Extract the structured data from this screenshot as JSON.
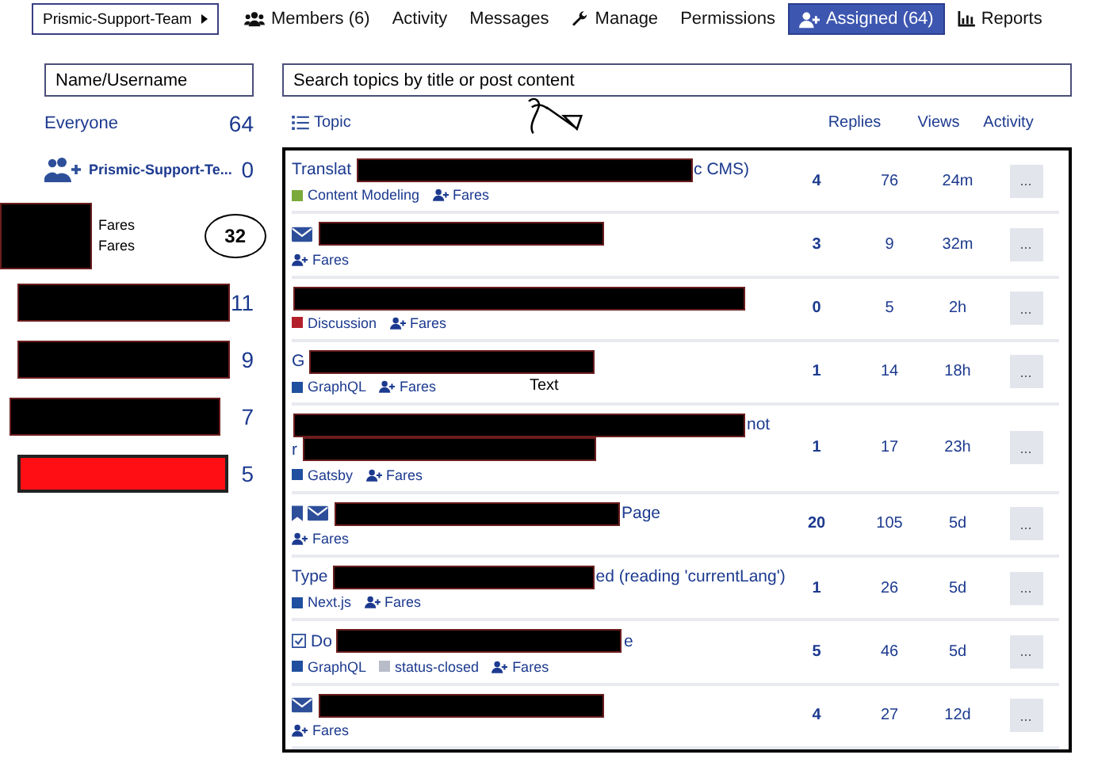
{
  "nav": {
    "group_button": "Prismic-Support-Team",
    "tabs": [
      {
        "label": "Members (6)",
        "selected": false
      },
      {
        "label": "Activity",
        "selected": false
      },
      {
        "label": "Messages",
        "selected": false
      },
      {
        "label": "Manage",
        "selected": false
      },
      {
        "label": "Permissions",
        "selected": false
      },
      {
        "label": "Assigned (64)",
        "selected": true
      },
      {
        "label": "Reports",
        "selected": false
      }
    ]
  },
  "sidebar": {
    "filter": {
      "placeholder": "Name/Username"
    },
    "items": [
      {
        "kind": "all",
        "label": "Everyone",
        "count": "64",
        "circled": false
      },
      {
        "kind": "group",
        "label": "Prismic-Support-Te...",
        "count": "0",
        "circled": false
      },
      {
        "kind": "member",
        "lines": [
          "Fares",
          "Fares"
        ],
        "color": "#000000",
        "count": "32",
        "circled": true
      },
      {
        "kind": "member",
        "color": "#000000",
        "count": "11",
        "circled": false
      },
      {
        "kind": "member",
        "color": "#000000",
        "count": "9",
        "circled": false
      },
      {
        "kind": "member",
        "color": "#000000",
        "count": "7",
        "circled": false
      },
      {
        "kind": "member",
        "color": "#ff0f13",
        "count": "5",
        "circled": false
      }
    ]
  },
  "search": {
    "placeholder": "Search topics by title or post content"
  },
  "columns": [
    "Topic",
    "Replies",
    "Views",
    "Activity"
  ],
  "handwritten_note": "Text",
  "topics": [
    {
      "bookmarked": false,
      "message": false,
      "solved": false,
      "segments": [
        {
          "kind": "text",
          "text": "Translat"
        },
        {
          "kind": "redaction"
        },
        {
          "kind": "text",
          "text": "c CMS)"
        }
      ],
      "tags": [
        {
          "label": "Content Modeling",
          "color": "#7aaa3a"
        }
      ],
      "assignee": "Fares",
      "replies": "4",
      "views": "76",
      "activity": "24m",
      "menu": "..."
    },
    {
      "bookmarked": false,
      "message": true,
      "solved": false,
      "segments": [
        {
          "kind": "redaction"
        }
      ],
      "assignee": "Fares",
      "replies": "3",
      "views": "9",
      "activity": "32m",
      "menu": "..."
    },
    {
      "bookmarked": false,
      "message": false,
      "solved": false,
      "segments": [
        {
          "kind": "redaction"
        }
      ],
      "tags": [
        {
          "label": "Discussion",
          "color": "#b3202a"
        }
      ],
      "assignee": "Fares",
      "replies": "0",
      "views": "5",
      "activity": "2h",
      "menu": "..."
    },
    {
      "bookmarked": false,
      "message": false,
      "solved": false,
      "segments": [
        {
          "kind": "text",
          "text": "G"
        },
        {
          "kind": "redaction"
        }
      ],
      "tags": [
        {
          "label": "GraphQL",
          "color": "#1f4f9e"
        }
      ],
      "assignee": "Fares",
      "replies": "1",
      "views": "14",
      "activity": "18h",
      "menu": "..."
    },
    {
      "bookmarked": false,
      "message": false,
      "solved": false,
      "segments": [
        {
          "kind": "redaction"
        },
        {
          "kind": "text",
          "text": "not"
        },
        {
          "kind": "break"
        },
        {
          "kind": "text",
          "text": "r"
        },
        {
          "kind": "redaction"
        }
      ],
      "tags": [
        {
          "label": "Gatsby",
          "color": "#1f4f9e"
        }
      ],
      "assignee": "Fares",
      "replies": "1",
      "views": "17",
      "activity": "23h",
      "menu": "..."
    },
    {
      "bookmarked": true,
      "message": true,
      "solved": false,
      "segments": [
        {
          "kind": "redaction"
        },
        {
          "kind": "text",
          "text": "Page"
        }
      ],
      "assignee": "Fares",
      "replies": "20",
      "views": "105",
      "activity": "5d",
      "menu": "..."
    },
    {
      "bookmarked": false,
      "message": false,
      "solved": false,
      "segments": [
        {
          "kind": "text",
          "text": "Type"
        },
        {
          "kind": "redaction"
        },
        {
          "kind": "text",
          "text": "ed (reading 'currentLang')"
        }
      ],
      "tags": [
        {
          "label": "Next.js",
          "color": "#1f4f9e"
        }
      ],
      "assignee": "Fares",
      "replies": "1",
      "views": "26",
      "activity": "5d",
      "menu": "..."
    },
    {
      "bookmarked": false,
      "message": false,
      "solved": true,
      "segments": [
        {
          "kind": "text",
          "text": "Do"
        },
        {
          "kind": "redaction"
        },
        {
          "kind": "text",
          "text": "e"
        }
      ],
      "tags": [
        {
          "label": "GraphQL",
          "color": "#1f4f9e"
        },
        {
          "label": "status-closed",
          "color": "#b8bcc8"
        }
      ],
      "assignee": "Fares",
      "replies": "5",
      "views": "46",
      "activity": "5d",
      "menu": "..."
    },
    {
      "bookmarked": false,
      "message": true,
      "solved": false,
      "segments": [
        {
          "kind": "redaction"
        }
      ],
      "assignee": "Fares",
      "replies": "4",
      "views": "27",
      "activity": "12d",
      "menu": "..."
    }
  ]
}
